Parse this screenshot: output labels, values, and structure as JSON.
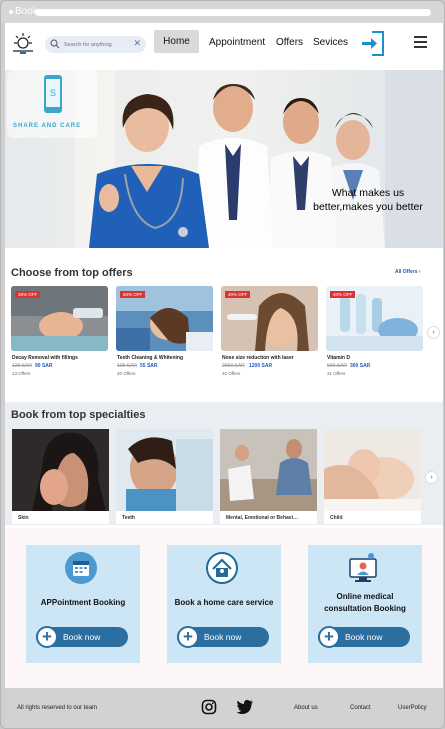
{
  "window": {
    "title": "Book"
  },
  "header": {
    "search_placeholder": "Search for anything",
    "search_clear": "✕",
    "nav": [
      "Home",
      "Appointment",
      "Offers",
      "Sevices"
    ]
  },
  "hero": {
    "brand_letter": "S",
    "brand_name": "SHARE AND CARE",
    "tagline_line1": "What makes us",
    "tagline_line2": "better,makes you better"
  },
  "offers": {
    "title": "Choose from top offers",
    "all_label": "All Offers",
    "all_arrow": "›",
    "next_arrow": "›",
    "items": [
      {
        "badge": "25% OFF",
        "name": "Decay Removal with fillings",
        "old": "120 SAR",
        "new": "90 SAR",
        "count": "13 Offers"
      },
      {
        "badge": "50% OFF",
        "name": "Teeth Cleaning & Whitening",
        "old": "105 SAR",
        "new": "55 SAR",
        "count": "40 Offers"
      },
      {
        "badge": "40% OFF",
        "name": "Nose size reduction with laser",
        "old": "2000 SAR",
        "new": "1200 SAR",
        "count": "32 Offers"
      },
      {
        "badge": "40% OFF",
        "name": "Vitamin D",
        "old": "500 SAR",
        "new": "300 SAR",
        "count": "31 Offers"
      }
    ]
  },
  "specialties": {
    "title": "Book from top specialties",
    "next_arrow": "›",
    "items": [
      "Skin",
      "Teeth",
      "Mental, Emotional or Behavi…",
      "Child"
    ]
  },
  "services": [
    {
      "title": "APPointment Booking",
      "button": "Book now",
      "icon": "calendar-icon"
    },
    {
      "title": "Book a home care service",
      "button": "Book now",
      "icon": "home-care-icon"
    },
    {
      "title": "Online medical consultation Booking",
      "button": "Book now",
      "icon": "online-consultation-icon"
    }
  ],
  "footer": {
    "copyright": "All rights reserved to our team",
    "links": [
      "About us",
      "Contact",
      "UserPolicy"
    ]
  },
  "colors": {
    "accent": "#2a6fa0",
    "card_bg": "#cde6f5",
    "link": "#2158c4",
    "badge": "#d93434"
  }
}
